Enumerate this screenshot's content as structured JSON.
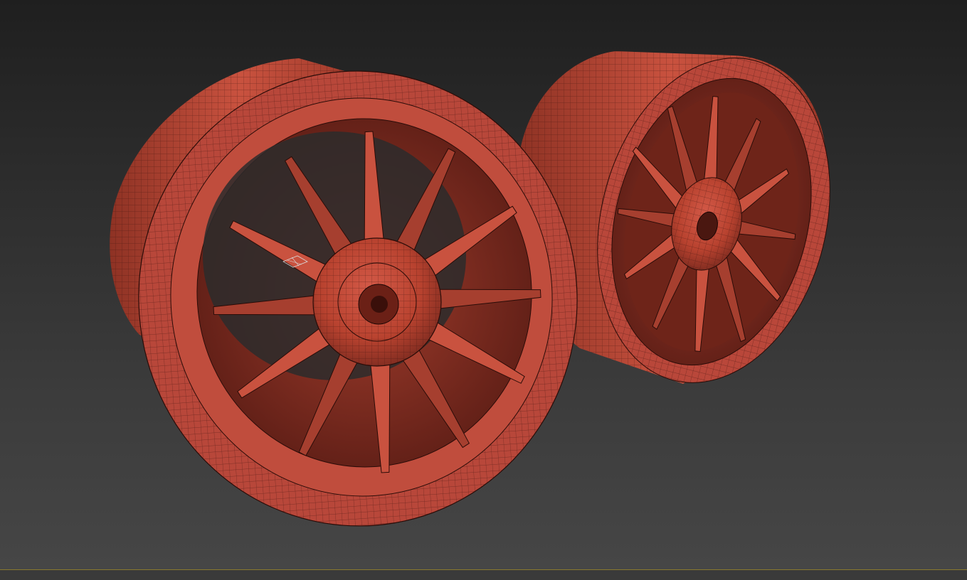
{
  "app": {
    "kind": "3d-modeling-viewport"
  },
  "viewport": {
    "display_mode": "shaded-with-edged-faces",
    "objects": [
      {
        "name_icon": "wheel-rim-front",
        "color": "#c0483a"
      },
      {
        "name_icon": "wheel-rim-back",
        "color": "#c0483a"
      }
    ],
    "active_border_color": "#8a7a2e",
    "background_top": "#1f1f1f",
    "background_bottom": "#464646",
    "spoke_count": 12
  }
}
